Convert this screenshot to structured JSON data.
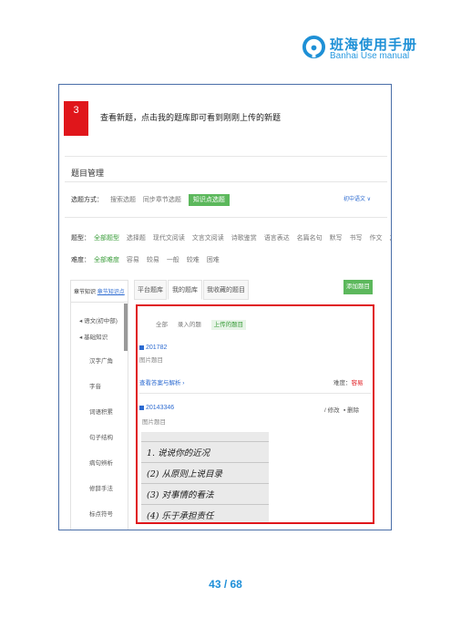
{
  "header": {
    "logo_title": "班海使用手册",
    "logo_subtitle": "Banhai Use manual",
    "brand_color": "#1e90d6"
  },
  "step": {
    "number": "3",
    "text": "查看新题，点击我的题库即可看到刚刚上传的新题"
  },
  "panel": {
    "title": "题目管理",
    "select_label": "选题方式：",
    "select_options": [
      "搜索选题",
      "同步章节选题",
      "知识点选题"
    ],
    "grade_switch": "初中语文 ∨",
    "type_label": "题型：",
    "type_options": [
      "全部题型",
      "选择题",
      "现代文阅读",
      "文言文阅读",
      "诗歌鉴赏",
      "语言表达",
      "名篇名句",
      "默写",
      "书写",
      "作文",
      "其他"
    ],
    "diff_label": "难度：",
    "diff_options": [
      "全部难度",
      "容易",
      "较易",
      "一般",
      "较难",
      "困难"
    ]
  },
  "left_nav": {
    "header_prefix": "章节知识",
    "header_link": "章节知识点",
    "items": [
      "◂ 语文(初中部)",
      "◂ 基础知识",
      "汉字广角",
      "字音",
      "词语积累",
      "句子结构",
      "病句辨析",
      "修辞手法",
      "标点符号"
    ]
  },
  "tabs": [
    "平台题库",
    "我的题库",
    "我收藏的题目"
  ],
  "add_button": "添加题目",
  "results": {
    "filters": [
      "全部",
      "录入的题",
      "上传的题目"
    ],
    "item1": {
      "id": "201782",
      "type": "图片题目",
      "link": "查看答案与解析 ›",
      "difficulty_label": "难度：",
      "difficulty_value": "容易"
    },
    "item2": {
      "id": "20143346",
      "type": "图片题目",
      "edit": "/ 修改",
      "delete": "删除"
    },
    "handwriting": [
      "1. 说说你的近况",
      "(2) 从原则上说目录",
      "(3) 对事情的看法",
      "(4) 乐于承担责任"
    ]
  },
  "footer": {
    "page_current": "43",
    "page_total": "68",
    "page_text": "43 / 68"
  }
}
